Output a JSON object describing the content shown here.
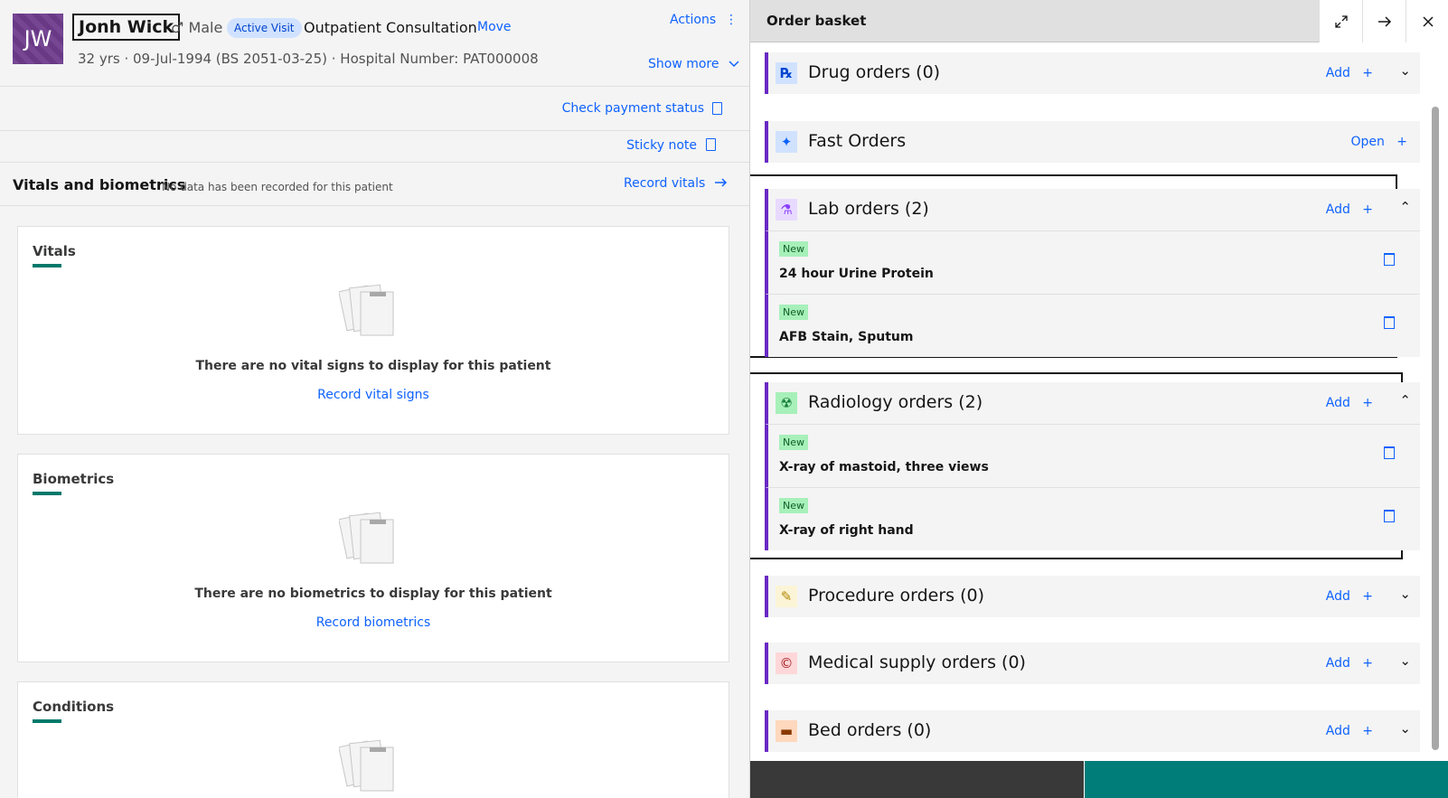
{
  "patient": {
    "initials": "JW",
    "name": "Jonh Wick",
    "gender_symbol": "♂",
    "gender": "Male",
    "visit_badge": "Active Visit",
    "visit_type": "Outpatient Consultation",
    "move_label": "Move",
    "actions_label": "Actions",
    "meta": "32 yrs  ·  09-Jul-1994 (BS 2051-03-25)  ·  Hospital Number: PAT000008",
    "show_more_label": "Show more"
  },
  "toolbar": {
    "check_payment_label": "Check payment status",
    "sticky_note_label": "Sticky note"
  },
  "vitals_header": {
    "title": "Vitals and biometrics",
    "subtitle": "No data has been recorded for this patient",
    "record_label": "Record vitals"
  },
  "cards": {
    "vitals": {
      "title": "Vitals",
      "empty_text": "There are no vital signs to display for this patient",
      "link": "Record vital signs"
    },
    "biometrics": {
      "title": "Biometrics",
      "empty_text": "There are no biometrics to display for this patient",
      "link": "Record biometrics"
    },
    "conditions": {
      "title": "Conditions"
    }
  },
  "basket": {
    "title": "Order basket",
    "sections": {
      "drug": {
        "title": "Drug orders (0)",
        "action": "Add",
        "icon": "rx-icon"
      },
      "fast": {
        "title": "Fast Orders",
        "action": "Open",
        "icon": "pin-icon"
      },
      "lab": {
        "title": "Lab orders (2)",
        "action": "Add",
        "icon": "flask-icon"
      },
      "radiology": {
        "title": "Radiology orders (2)",
        "action": "Add",
        "icon": "xray-icon"
      },
      "procedure": {
        "title": "Procedure orders (0)",
        "action": "Add",
        "icon": "syringe-icon"
      },
      "supply": {
        "title": "Medical supply orders (0)",
        "action": "Add",
        "icon": "bottle-icon"
      },
      "bed": {
        "title": "Bed orders (0)",
        "action": "Add",
        "icon": "bed-icon"
      }
    },
    "lab_items": [
      {
        "badge": "New",
        "name": "24 hour Urine Protein"
      },
      {
        "badge": "New",
        "name": "AFB Stain, Sputum"
      }
    ],
    "radiology_items": [
      {
        "badge": "New",
        "name": "X-ray of mastoid, three views"
      },
      {
        "badge": "New",
        "name": "X-ray of right hand"
      }
    ]
  },
  "colors": {
    "link": "#0f62fe",
    "accent_purple": "#6929c4",
    "teal": "#00796b",
    "new_badge_bg": "#a7f0ba"
  }
}
